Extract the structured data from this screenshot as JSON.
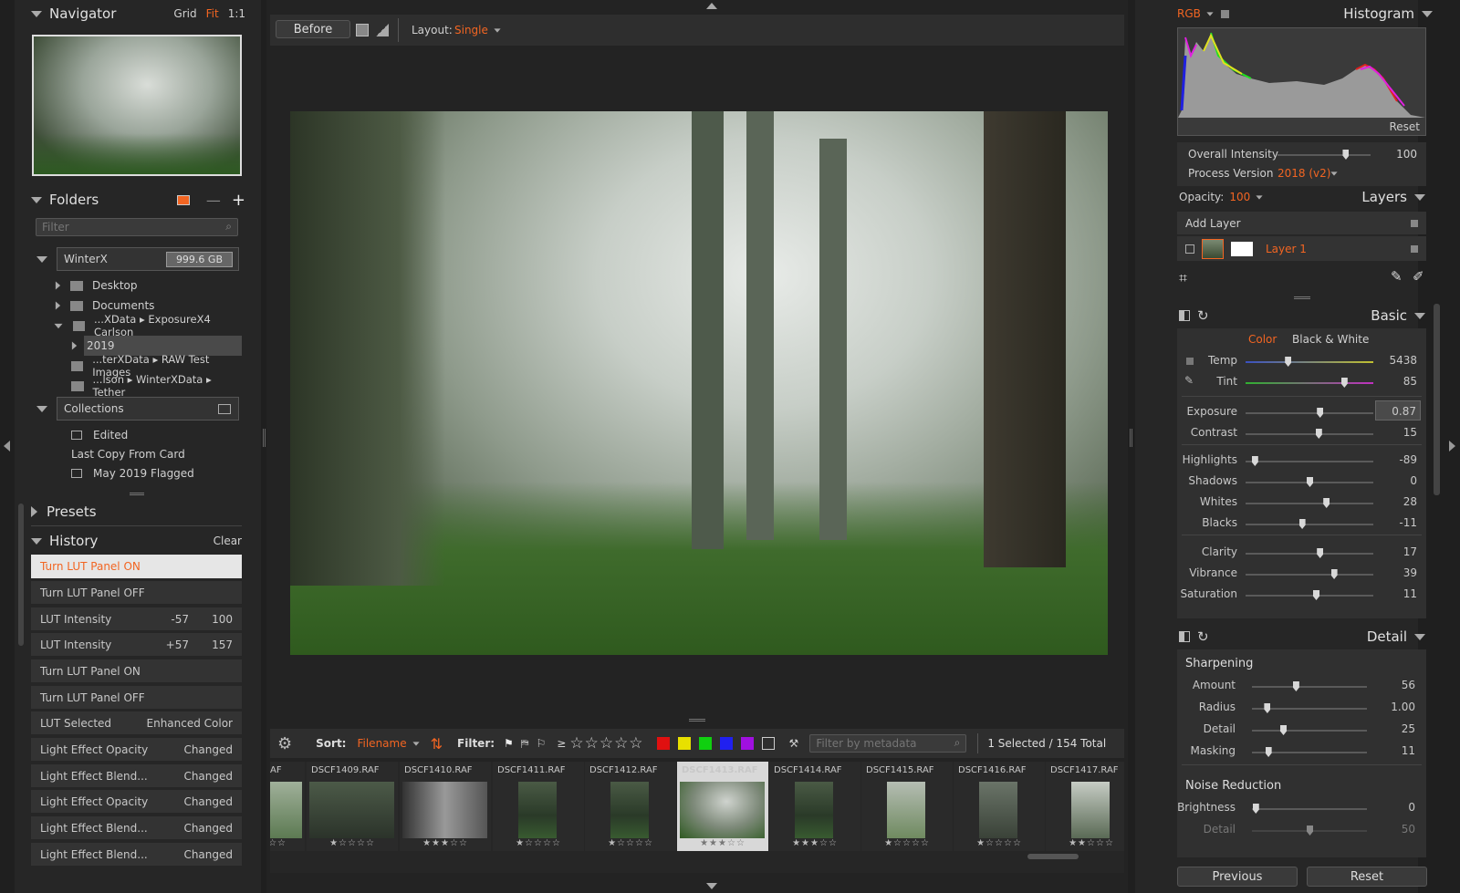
{
  "navigator": {
    "title": "Navigator",
    "grid": "Grid",
    "fit": "Fit",
    "one": "1:1"
  },
  "folders": {
    "title": "Folders",
    "filter_placeholder": "Filter",
    "drive": "WinterX",
    "drive_size": "999.6 GB",
    "items": [
      "Desktop",
      "Documents",
      "...XData ▸ ExposureX4 Carlson",
      "2019",
      "...terXData ▸ RAW Test Images",
      "...lson ▸ WinterXData ▸ Tether"
    ],
    "collections": "Collections",
    "collection_items": [
      "Edited",
      "Last Copy From Card",
      "May 2019 Flagged"
    ]
  },
  "presets": {
    "title": "Presets"
  },
  "history": {
    "title": "History",
    "clear": "Clear",
    "items": [
      {
        "label": "Turn LUT Panel ON",
        "a": "",
        "b": ""
      },
      {
        "label": "Turn LUT Panel OFF",
        "a": "",
        "b": ""
      },
      {
        "label": "LUT Intensity",
        "a": "-57",
        "b": "100"
      },
      {
        "label": "LUT Intensity",
        "a": "+57",
        "b": "157"
      },
      {
        "label": "Turn LUT Panel ON",
        "a": "",
        "b": ""
      },
      {
        "label": "Turn LUT Panel OFF",
        "a": "",
        "b": ""
      },
      {
        "label": "LUT Selected",
        "a": "",
        "b": "Enhanced Color"
      },
      {
        "label": "Light Effect Opacity",
        "a": "",
        "b": "Changed"
      },
      {
        "label": "Light Effect Blend...",
        "a": "",
        "b": "Changed"
      },
      {
        "label": "Light Effect Opacity",
        "a": "",
        "b": "Changed"
      },
      {
        "label": "Light Effect Blend...",
        "a": "",
        "b": "Changed"
      },
      {
        "label": "Light Effect Blend...",
        "a": "",
        "b": "Changed"
      }
    ]
  },
  "toolbar": {
    "before": "Before",
    "layout_label": "Layout:",
    "layout_value": "Single"
  },
  "filterbar": {
    "sort_label": "Sort:",
    "sort_value": "Filename",
    "filter_label": "Filter:",
    "ge": "≥",
    "stars": "☆☆☆☆☆",
    "metadata_placeholder": "Filter by metadata",
    "count": "1 Selected / 154 Total"
  },
  "filmstrip": [
    {
      "name": "AF",
      "stars": "☆☆"
    },
    {
      "name": "DSCF1409.RAF",
      "stars": "★☆☆☆☆"
    },
    {
      "name": "DSCF1410.RAF",
      "stars": "★★★☆☆"
    },
    {
      "name": "DSCF1411.RAF",
      "stars": "★☆☆☆☆"
    },
    {
      "name": "DSCF1412.RAF",
      "stars": "★☆☆☆☆"
    },
    {
      "name": "DSCF1413.RAF",
      "stars": "★★★☆☆"
    },
    {
      "name": "DSCF1414.RAF",
      "stars": "★★★☆☆"
    },
    {
      "name": "DSCF1415.RAF",
      "stars": "★☆☆☆☆"
    },
    {
      "name": "DSCF1416.RAF",
      "stars": "★☆☆☆☆"
    },
    {
      "name": "DSCF1417.RAF",
      "stars": "★★☆☆☆"
    }
  ],
  "histogram": {
    "mode": "RGB",
    "title": "Histogram",
    "reset": "Reset"
  },
  "overall": {
    "label": "Overall Intensity",
    "value": "100",
    "level": 0.73
  },
  "process": {
    "label": "Process Version",
    "value": "2018 (v2)"
  },
  "opacity": {
    "label": "Opacity:",
    "value": "100"
  },
  "layers": {
    "title": "Layers",
    "add": "Add Layer",
    "layer1": "Layer 1"
  },
  "basic": {
    "title": "Basic",
    "color": "Color",
    "bw": "Black & White",
    "sliders": [
      {
        "label": "Temp",
        "value": "5438",
        "level": 0.33
      },
      {
        "label": "Tint",
        "value": "85",
        "level": 0.77
      },
      {
        "label": "Exposure",
        "value": "0.87",
        "level": 0.58
      },
      {
        "label": "Contrast",
        "value": "15",
        "level": 0.57
      },
      {
        "label": "Highlights",
        "value": "-89",
        "level": 0.07
      },
      {
        "label": "Shadows",
        "value": "0",
        "level": 0.5
      },
      {
        "label": "Whites",
        "value": "28",
        "level": 0.63
      },
      {
        "label": "Blacks",
        "value": "-11",
        "level": 0.44
      },
      {
        "label": "Clarity",
        "value": "17",
        "level": 0.58
      },
      {
        "label": "Vibrance",
        "value": "39",
        "level": 0.69
      },
      {
        "label": "Saturation",
        "value": "11",
        "level": 0.55
      }
    ]
  },
  "detail": {
    "title": "Detail",
    "sharpening": "Sharpening",
    "sharp": [
      {
        "label": "Amount",
        "value": "56",
        "level": 0.38
      },
      {
        "label": "Radius",
        "value": "1.00",
        "level": 0.13
      },
      {
        "label": "Detail",
        "value": "25",
        "level": 0.27
      },
      {
        "label": "Masking",
        "value": "11",
        "level": 0.14
      }
    ],
    "noise": "Noise Reduction",
    "noise_sliders": [
      {
        "label": "Brightness",
        "value": "0",
        "level": 0.03
      },
      {
        "label": "Detail",
        "value": "50",
        "level": 0.5
      }
    ]
  },
  "footer": {
    "previous": "Previous",
    "reset": "Reset"
  }
}
